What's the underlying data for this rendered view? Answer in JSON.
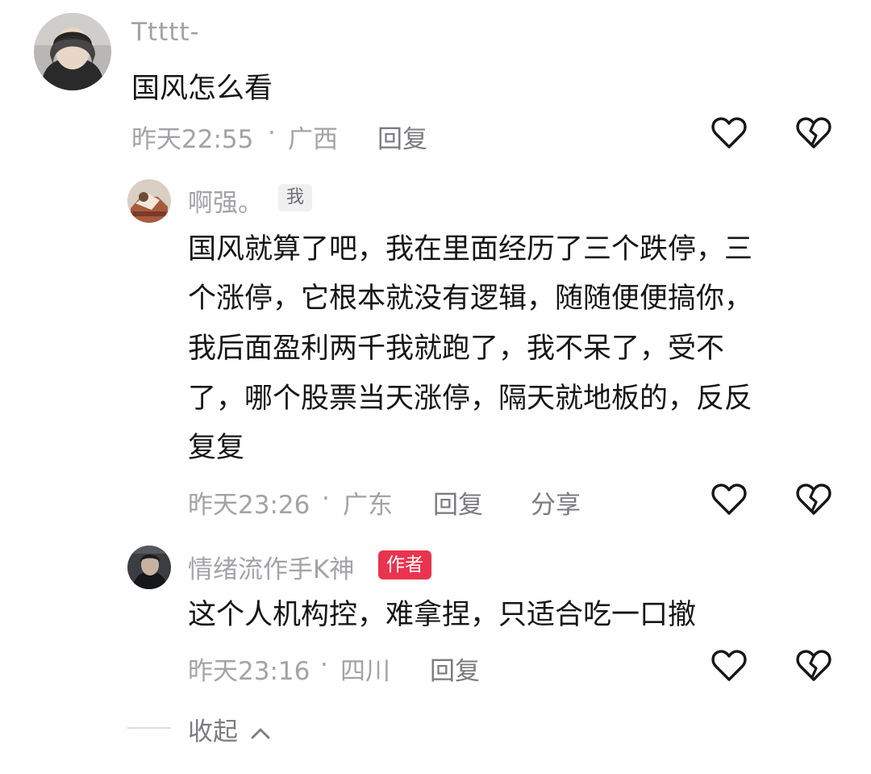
{
  "comment": {
    "username": "Ttttt-",
    "text": "国风怎么看",
    "time": "昨天22:55",
    "separator": "·",
    "location": "广西",
    "reply_label": "回复",
    "like_icon": "heart-outline-icon",
    "dislike_icon": "broken-heart-icon"
  },
  "replies": [
    {
      "username": "啊强。",
      "badge": "我",
      "text_lines": [
        "国风就算了吧，我在里面经历了三个跌停，三",
        "个涨停，它根本就没有逻辑，随随便便搞你，",
        "我后面盈利两千我就跑了，我不呆了，受不",
        "了，哪个股票当天涨停，隔天就地板的，反反",
        "复复"
      ],
      "time": "昨天23:26",
      "separator": "·",
      "location": "广东",
      "reply_label": "回复",
      "share_label": "分享"
    },
    {
      "username": "情绪流作手K神",
      "badge": "作者",
      "text_lines": [
        "这个人机构控，难拿捏，只适合吃一口撤"
      ],
      "time": "昨天23:16",
      "separator": "·",
      "location": "四川",
      "reply_label": "回复"
    }
  ],
  "collapse": {
    "label": "收起",
    "icon": "chevron-up-icon"
  },
  "colors": {
    "meta_text": "#a3a3a7",
    "author_badge": "#e8344e",
    "me_badge_bg": "#f0f0f2"
  }
}
